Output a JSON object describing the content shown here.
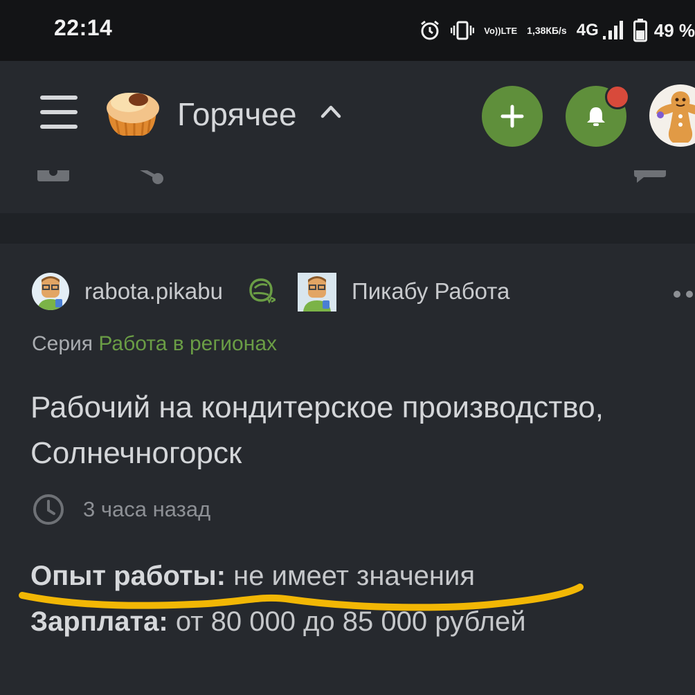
{
  "status_bar": {
    "time": "22:14",
    "volte": "Vo))",
    "lte": "LTE",
    "speed_value": "1,38",
    "speed_unit": "КБ/s",
    "network": "4G",
    "battery": "49 %"
  },
  "app_bar": {
    "section": "Горячее",
    "icons": [
      "menu-icon",
      "cupcake-logo",
      "chevron-up-icon",
      "plus-icon",
      "bell-icon",
      "avatar"
    ],
    "accent": "#5f8f3b",
    "notification_color": "#d84a3b"
  },
  "post": {
    "author": "rabota.pikabu",
    "community": "Пикабу Работа",
    "series_label": "Серия",
    "series_name": "Работа в регионах",
    "series_color": "#6a9d45",
    "title": "Рабочий на кондитерское производство, Солнечногорск",
    "time": "3 часа назад",
    "experience_label": "Опыт работы:",
    "experience_value": " не имеет значения",
    "salary_label": "Зарплата:",
    "salary_value": " от 80 000 до 85 000 рублей",
    "annotation_color": "#f2b705"
  }
}
